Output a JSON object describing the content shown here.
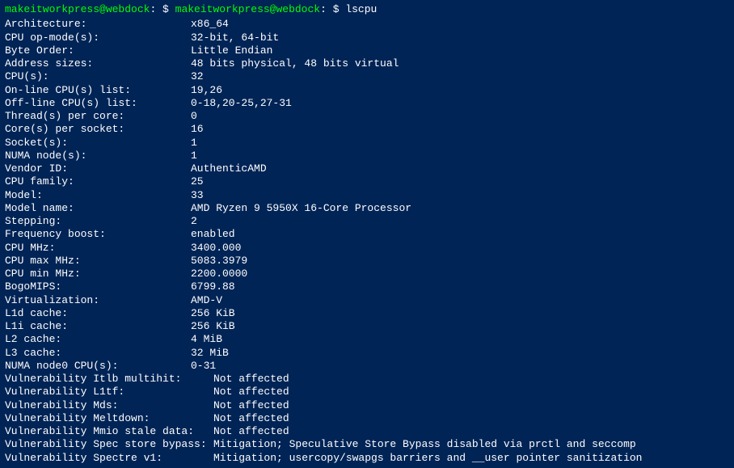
{
  "prompt": {
    "userhost": "makeitworkpress@webdock",
    "dollar": " $ ",
    "command": "lscpu"
  },
  "rows": [
    {
      "label": "Architecture:",
      "value": "x86_64"
    },
    {
      "label": "CPU op-mode(s):",
      "value": "32-bit, 64-bit"
    },
    {
      "label": "Byte Order:",
      "value": "Little Endian"
    },
    {
      "label": "Address sizes:",
      "value": "48 bits physical, 48 bits virtual"
    },
    {
      "label": "CPU(s):",
      "value": "32"
    },
    {
      "label": "On-line CPU(s) list:",
      "value": "19,26"
    },
    {
      "label": "Off-line CPU(s) list:",
      "value": "0-18,20-25,27-31"
    },
    {
      "label": "Thread(s) per core:",
      "value": "0"
    },
    {
      "label": "Core(s) per socket:",
      "value": "16"
    },
    {
      "label": "Socket(s):",
      "value": "1"
    },
    {
      "label": "NUMA node(s):",
      "value": "1"
    },
    {
      "label": "Vendor ID:",
      "value": "AuthenticAMD"
    },
    {
      "label": "CPU family:",
      "value": "25"
    },
    {
      "label": "Model:",
      "value": "33"
    },
    {
      "label": "Model name:",
      "value": "AMD Ryzen 9 5950X 16-Core Processor"
    },
    {
      "label": "Stepping:",
      "value": "2"
    },
    {
      "label": "Frequency boost:",
      "value": "enabled"
    },
    {
      "label": "CPU MHz:",
      "value": "3400.000"
    },
    {
      "label": "CPU max MHz:",
      "value": "5083.3979"
    },
    {
      "label": "CPU min MHz:",
      "value": "2200.0000"
    },
    {
      "label": "BogoMIPS:",
      "value": "6799.88"
    },
    {
      "label": "Virtualization:",
      "value": "AMD-V"
    },
    {
      "label": "L1d cache:",
      "value": "256 KiB"
    },
    {
      "label": "L1i cache:",
      "value": "256 KiB"
    },
    {
      "label": "L2 cache:",
      "value": "4 MiB"
    },
    {
      "label": "L3 cache:",
      "value": "32 MiB"
    },
    {
      "label": "NUMA node0 CPU(s):",
      "value": "0-31"
    }
  ],
  "wide_rows": [
    {
      "label": "Vulnerability Itlb multihit:",
      "value": "Not affected"
    },
    {
      "label": "Vulnerability L1tf:",
      "value": "Not affected"
    },
    {
      "label": "Vulnerability Mds:",
      "value": "Not affected"
    },
    {
      "label": "Vulnerability Meltdown:",
      "value": "Not affected"
    },
    {
      "label": "Vulnerability Mmio stale data:",
      "value": "Not affected"
    },
    {
      "label": "Vulnerability Spec store bypass:",
      "value": "Mitigation; Speculative Store Bypass disabled via prctl and seccomp"
    },
    {
      "label": "Vulnerability Spectre v1:",
      "value": "Mitigation; usercopy/swapgs barriers and __user pointer sanitization"
    }
  ]
}
